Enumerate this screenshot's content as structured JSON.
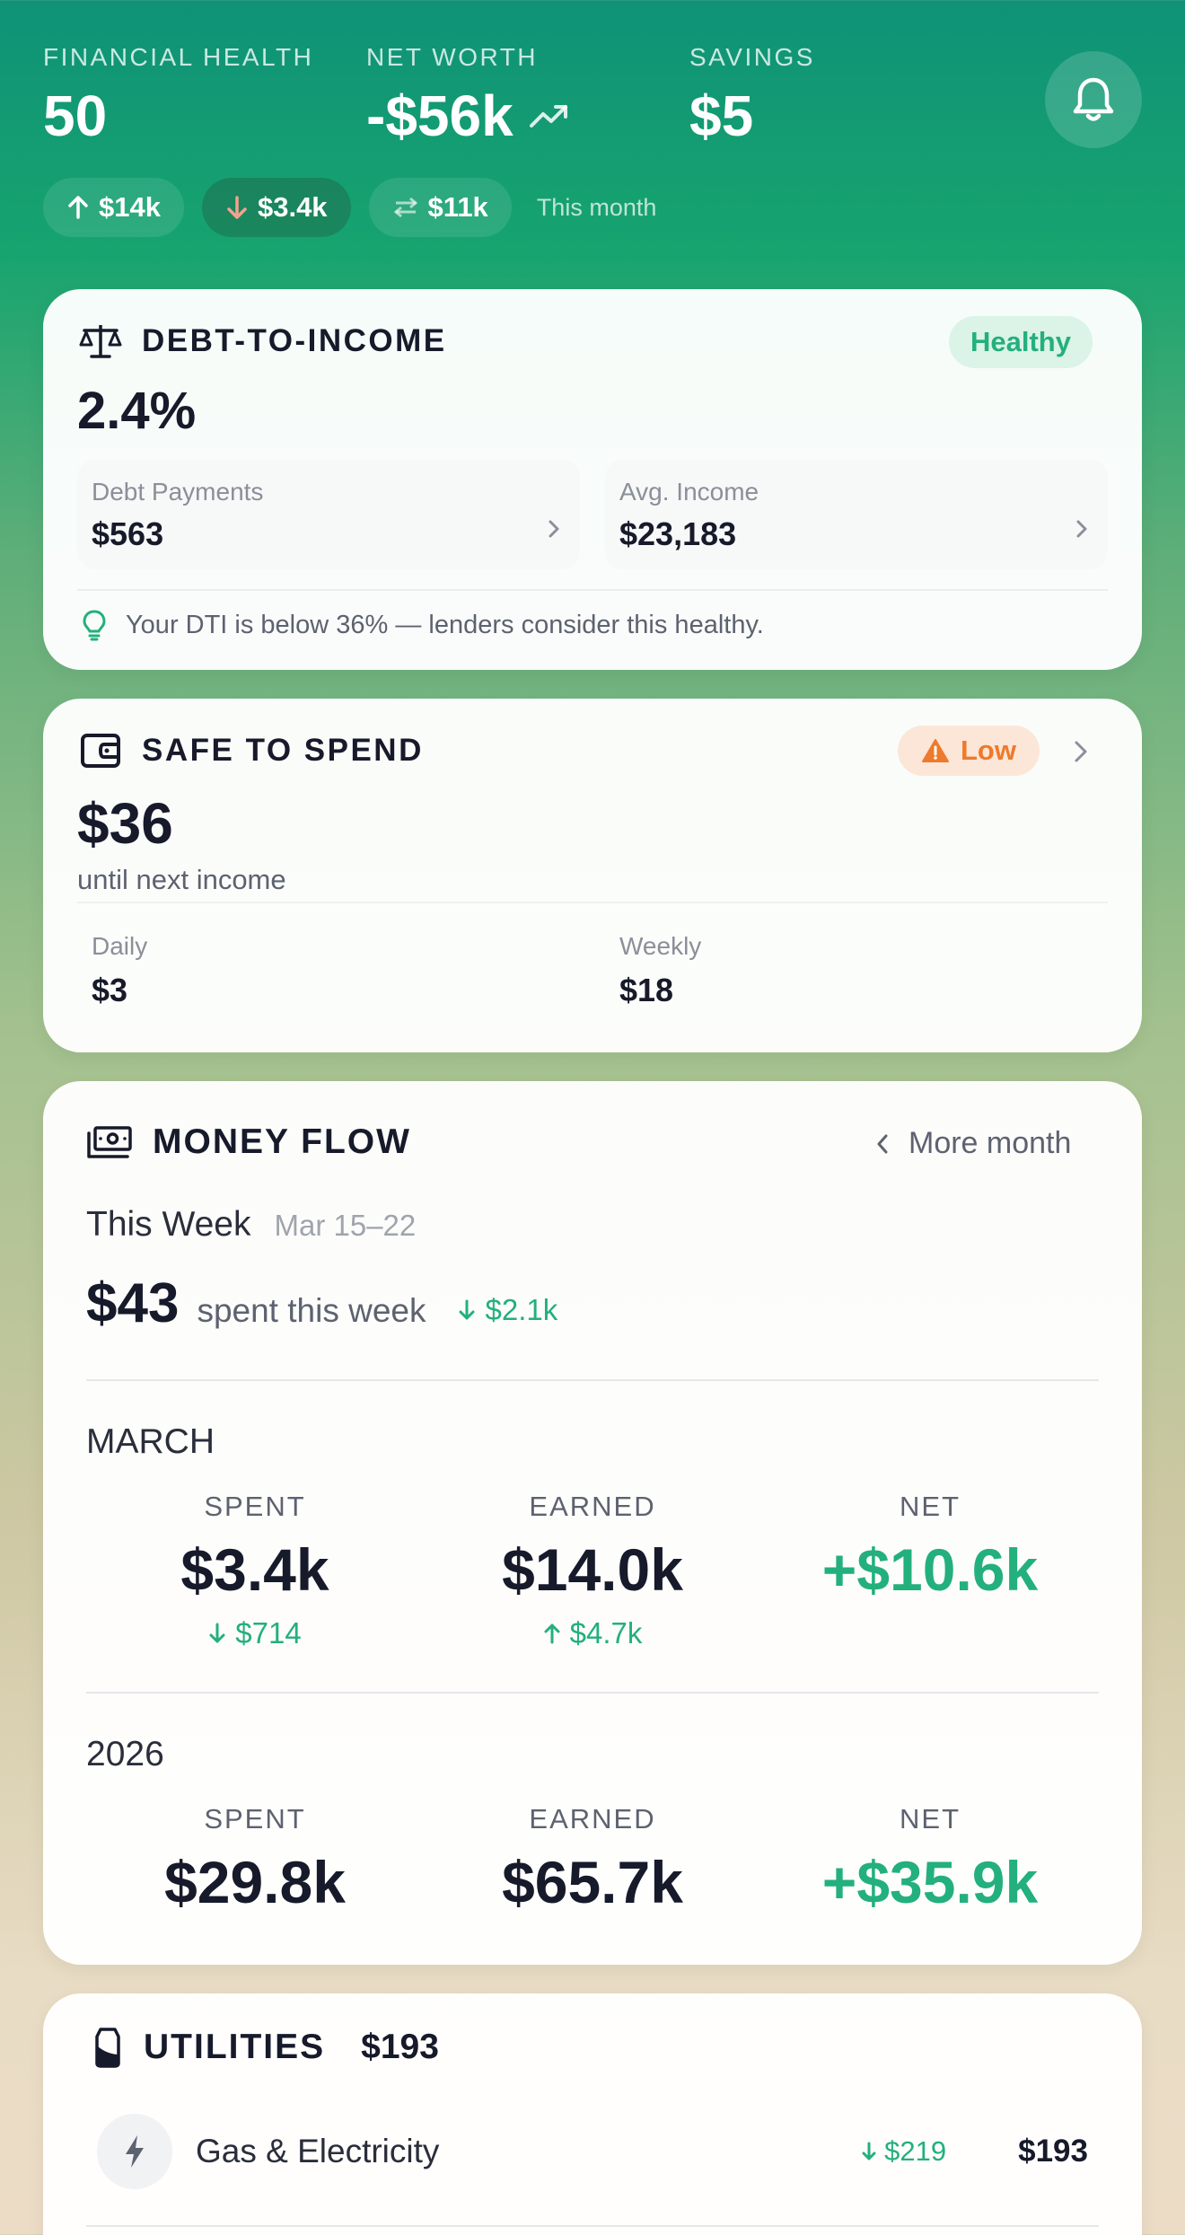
{
  "header": {
    "financial_health": {
      "label": "FINANCIAL HEALTH",
      "value": "50"
    },
    "net_worth": {
      "label": "NET WORTH",
      "value": "-$56k"
    },
    "savings": {
      "label": "SAVINGS",
      "value": "$5"
    },
    "chips": [
      {
        "arrow": "up",
        "value": "$14k"
      },
      {
        "arrow": "down",
        "value": "$3.4k"
      },
      {
        "arrow": "transfer",
        "value": "$11k"
      }
    ],
    "period_note": "This month"
  },
  "dti": {
    "title": "DEBT-TO-INCOME",
    "status": "Healthy",
    "value": "2.4%",
    "debt_payments": {
      "label": "Debt Payments",
      "value": "$563"
    },
    "avg_income": {
      "label": "Avg. Income",
      "value": "$23,183"
    },
    "tip": "Your DTI is below 36% — lenders consider this healthy."
  },
  "safe_to_spend": {
    "title": "SAFE TO SPEND",
    "status": "Low",
    "value": "$36",
    "caption": "until next income",
    "daily": {
      "label": "Daily",
      "value": "$3"
    },
    "weekly": {
      "label": "Weekly",
      "value": "$18"
    }
  },
  "money_flow": {
    "title": "MONEY FLOW",
    "more_link": "More month",
    "week": {
      "label": "This Week",
      "range": "Mar 15–22",
      "amount": "$43",
      "caption": "spent this week",
      "change": "$2.1k"
    },
    "month": {
      "label": "MARCH",
      "spent": {
        "label": "SPENT",
        "value": "$3.4k",
        "change": "$714"
      },
      "earned": {
        "label": "EARNED",
        "value": "$14.0k",
        "change": "$4.7k"
      },
      "net": {
        "label": "NET",
        "value": "+$10.6k"
      }
    },
    "year": {
      "label": "2026",
      "spent": {
        "label": "SPENT",
        "value": "$29.8k"
      },
      "earned": {
        "label": "EARNED",
        "value": "$65.7k"
      },
      "net": {
        "label": "NET",
        "value": "+$35.9k"
      }
    }
  },
  "utilities": {
    "title": "UTILITIES",
    "total": "$193",
    "items": [
      {
        "name": "Gas & Electricity",
        "change": "$219",
        "amount": "$193"
      }
    ]
  },
  "colors": {
    "accent_green": "#23b07c",
    "warning_orange": "#ee7a2b",
    "text_dark": "#161a2a"
  }
}
